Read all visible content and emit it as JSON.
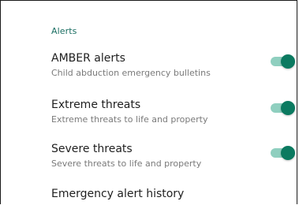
{
  "section": {
    "title": "Alerts"
  },
  "settings": [
    {
      "title": "AMBER alerts",
      "subtitle": "Child abduction emergency bulletins",
      "enabled": true
    },
    {
      "title": "Extreme threats",
      "subtitle": "Extreme threats to life and property",
      "enabled": true
    },
    {
      "title": "Severe threats",
      "subtitle": "Severe threats to life and property",
      "enabled": true
    },
    {
      "title": "Emergency alert history"
    }
  ],
  "colors": {
    "accent": "#0b7a60",
    "track": "#8fcfbf",
    "header": "#1a6e62"
  }
}
